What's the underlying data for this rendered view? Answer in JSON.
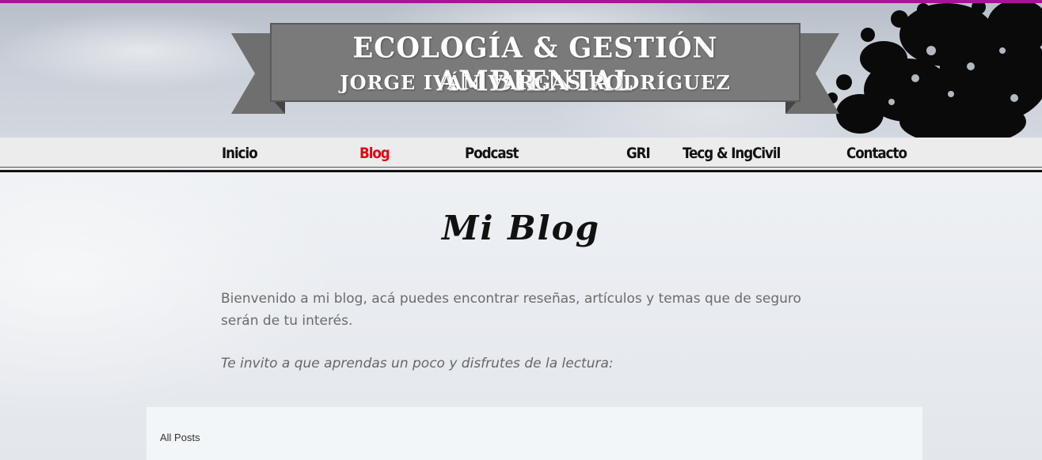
{
  "header": {
    "title": "ECOLOGÍA & GESTIÓN AMBIENTAL",
    "subtitle": "JORGE IVÁN VARGAS RODRÍGUEZ",
    "accent_color": "#a0169c"
  },
  "nav": {
    "items": [
      {
        "label": "Inicio",
        "active": false
      },
      {
        "label": "Blog",
        "active": true
      },
      {
        "label": "Podcast",
        "active": false
      },
      {
        "label": "GRI",
        "active": false
      },
      {
        "label": "Tecg & IngCivil",
        "active": false
      },
      {
        "label": "Contacto",
        "active": false
      }
    ],
    "active_color": "#e30613"
  },
  "main": {
    "title": "Mi Blog",
    "intro": "Bienvenido a mi blog, acá puedes encontrar reseñas, artículos y temas que de seguro serán de tu interés.",
    "invite": "Te invito a que aprendas un poco y disfrutes de la lectura:"
  },
  "posts": {
    "filter_label": "All Posts"
  }
}
